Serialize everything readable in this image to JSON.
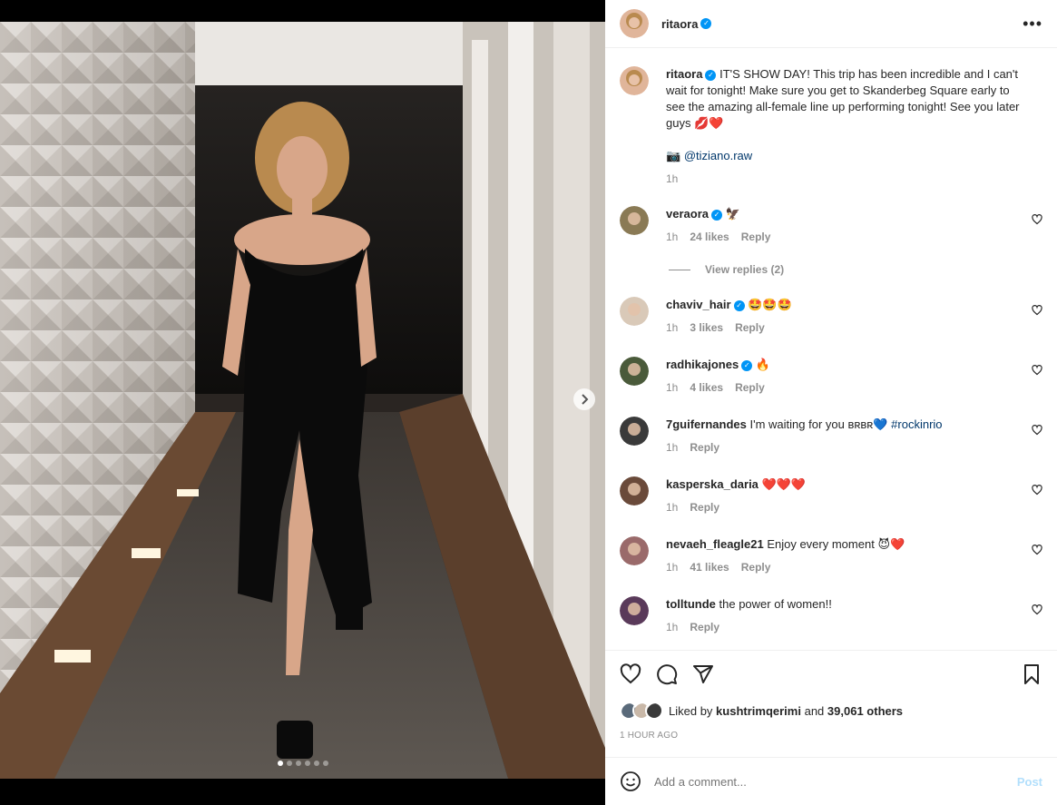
{
  "post": {
    "author": "ritaora",
    "caption_author": "ritaora",
    "caption": "IT'S SHOW DAY! This trip has been incredible and I can't wait for tonight! Make sure you get to Skanderbeg Square early to see the amazing all-female line up performing tonight! See you later guys",
    "caption_emoji": "💋❤️",
    "credit_emoji": "📷",
    "credit": "@tiziano.raw",
    "caption_time": "1h",
    "carousel_count": 6,
    "carousel_active": 0
  },
  "comments": [
    {
      "user": "veraora",
      "verified": true,
      "text": "",
      "emoji": "🦅",
      "time": "1h",
      "likes": "24 likes",
      "reply": "Reply",
      "avatar_color": "#8a7a55"
    },
    {
      "user": "chaviv_hair",
      "verified": true,
      "text": "",
      "emoji": "🤩🤩🤩",
      "time": "1h",
      "likes": "3 likes",
      "reply": "Reply",
      "avatar_color": "#d9c9b8"
    },
    {
      "user": "radhikajones",
      "verified": true,
      "text": "",
      "emoji": "🔥",
      "time": "1h",
      "likes": "4 likes",
      "reply": "Reply",
      "avatar_color": "#4a5a3a"
    },
    {
      "user": "7guifernandes",
      "verified": false,
      "text": "I'm waiting for you ʙʀʙʀ💙",
      "hashtag": "#rockinrio",
      "time": "1h",
      "likes": "",
      "reply": "Reply",
      "avatar_color": "#3a3a3a"
    },
    {
      "user": "kasperska_daria",
      "verified": false,
      "text": "",
      "emoji": "❤️❤️❤️",
      "time": "1h",
      "likes": "",
      "reply": "Reply",
      "avatar_color": "#6a4a3a"
    },
    {
      "user": "nevaeh_fleagle21",
      "verified": false,
      "text": "Enjoy every moment",
      "emoji": "😈❤️",
      "time": "1h",
      "likes": "41 likes",
      "reply": "Reply",
      "avatar_color": "#9a6a6a"
    },
    {
      "user": "tolltunde",
      "verified": false,
      "text": "the power of women!!",
      "time": "1h",
      "likes": "",
      "reply": "Reply",
      "avatar_color": "#5a3a5a"
    }
  ],
  "view_replies": "View replies (2)",
  "likes": {
    "prefix": "Liked by",
    "user": "kushtrimqerimi",
    "and": "and",
    "count": "39,061 others"
  },
  "time_ago": "1 HOUR AGO",
  "add_comment": {
    "placeholder": "Add a comment...",
    "post_label": "Post"
  },
  "colors": {
    "verified": "#0095f6",
    "link": "#00376b",
    "muted": "#8e8e8e",
    "post_disabled": "#b2dffc"
  },
  "icons": [
    "more-icon",
    "heart-icon",
    "comment-icon",
    "share-icon",
    "bookmark-icon",
    "emoji-icon",
    "chevron-right-icon"
  ]
}
